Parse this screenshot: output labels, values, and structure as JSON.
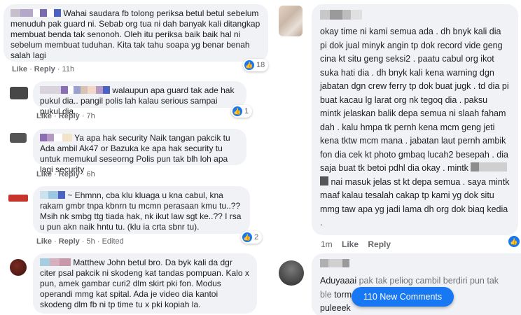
{
  "comments": [
    {
      "text": "Wahai saudara fb tolong periksa betul betul sebelum menuduh pak guard ni. Sebab org tua ni dah banyak kali ditangkap membuat benda tak senonoh. Oleh itu periksa baik baik hal ni sebelum membuat tuduhan. Kita tak tahu soapa yg benar benah salah lagi",
      "like": "Like",
      "reply": "Reply",
      "time": "11h",
      "reactions": "18"
    },
    {
      "text": "walaupun apa guard tak ade hak pukul dia.. pangil polis lah kalau serious sampai pukul dia..",
      "like": "Like",
      "reply": "Reply",
      "time": "7h",
      "reactions": "1"
    },
    {
      "text": "Ya apa hak security Naik tangan pakcik tu Ada ambil Ak47 or Bazuka ke apa hak security tu untuk memukul seseorng Polis pun tak blh loh apa lagi security",
      "like": "Like",
      "reply": "Reply",
      "time": "6h"
    },
    {
      "text": "~ Ehmnn, cba klu kluaga u kna cabul, kna rakam gmbr tnpa kbnrn tu mcmn perasaan kmu tu..?? Msih nk smbg ttg tiada hak, nk ikut law sgt ke..?? I rsa u pun akn naik hntu tu. (klu ia crta sbnr tu).",
      "like": "Like",
      "reply": "Reply",
      "time": "5h",
      "edited": "Edited",
      "reactions": "2"
    },
    {
      "name": "Matthew John",
      "text": "betul bro. Da byk kali da dgr citer psal pakcik ni skodeng kat tandas pompuan. Kalo x pun, amek gambar curi2 dlm skirt pki fon. Modus operandi mmg kat spital. Ada je video dia kantoi skodeng dlm fb ni tp time tu x pki kopiah la."
    }
  ],
  "right_comment": {
    "text": "okay time ni kami semua ada . dh bnyk kali dia pi dok jual minyk angin tp dok record vide geng cina kt situ geng seksi2 . paatu cabul org ikot suka hati dia . dh bnyk kali kena warning dgn jabatan dgn crew ferry tp dok buat jugk . td dia pi buat kacau lg larat org nk tegoq dia . paksu mintk jelaskan balik depa semua ni slaah faham dah . kalu hmpa tk pernh kena mcm geng jeti kena tktw mcm mana . jabatan laut pernh ambik fon dia cek kt photo gmbaq lucah2 besepah . dia saja buat tk betoi pdhl dia okay . mintk",
    "text_tail_a": "nai masuk jelas st kt depa semua . saya mintk maaf kalau tesalah cakap tp kami yg dok situ mmg taw apa yg jadi lama dh org dok biaq kedia .",
    "time": "1m",
    "like": "Like",
    "reply": "Reply"
  },
  "bottom_comment": {
    "text_a": "Aduyaaai",
    "text_b": "pak tak peliog cambil berdiri pun tak ble",
    "text_c": "torm rider",
    "text_d": "puleeek"
  },
  "new_comments_label": "110 New Comments",
  "colors": {
    "accent": "#1877f2",
    "bubble": "#f0f2f5",
    "meta": "#65676b"
  }
}
